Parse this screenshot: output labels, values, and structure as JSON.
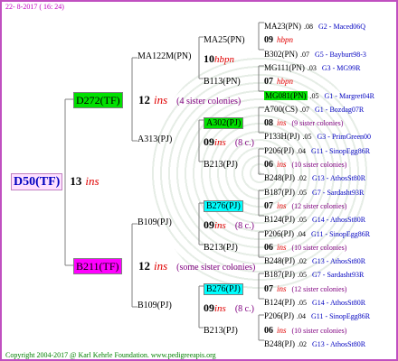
{
  "header": {
    "date": "22-  8-2017 ( 16: 24)"
  },
  "footer": {
    "copyright": "Copyright 2004-2017 @ Karl Kehrle Foundation.   www.pedigreeapis.org"
  },
  "colors": {
    "frame": "#c050c0",
    "highlight_green": "#00e000",
    "highlight_magenta": "#ff00ff",
    "highlight_cyan": "#00ffff",
    "ins_red": "#e00000",
    "link_blue": "#0000c0",
    "sisters_purple": "#800080"
  },
  "root": {
    "id": "D50(TF)",
    "ins_count": "13",
    "ins_label": "ins"
  },
  "gen1": [
    {
      "id": "D272(TF)",
      "ins_count": "12",
      "ins_label": "ins",
      "sisters": "(4 sister colonies)"
    },
    {
      "id": "B211(TF)",
      "ins_count": "12",
      "ins_label": "ins",
      "sisters": "(some sister colonies)"
    }
  ],
  "gen2": [
    "MA122M(PN)",
    "A313(PJ)",
    "B109(PJ)",
    "B109(PJ)"
  ],
  "gen3": [
    {
      "id": "MA25(PN)",
      "ins_count": "10",
      "ins_label": "hbpn"
    },
    {
      "id": "B113(PN)"
    },
    {
      "id": "A302(PJ)",
      "ins_count": "09",
      "ins_label": "ins",
      "sisters": "(8 c.)"
    },
    {
      "id": "B213(PJ)"
    },
    {
      "id": "B276(PJ)",
      "ins_count": "09",
      "ins_label": "ins",
      "sisters": "(8 c.)"
    },
    {
      "id": "B213(PJ)"
    },
    {
      "id": "B276(PJ)",
      "ins_count": "09",
      "ins_label": "ins",
      "sisters": "(8 c.)"
    },
    {
      "id": "B213(PJ)"
    }
  ],
  "gen4": [
    {
      "id": "MA23(PN)",
      "val": ".08",
      "loc": "G2 - Maced06Q"
    },
    {
      "note_count": "09",
      "note_label": "hbpn"
    },
    {
      "id": "B302(PN)",
      "val": ".07",
      "loc": "G5 - Bayburt98-3"
    },
    {
      "id": "MG111(PN)",
      "val": ".03",
      "loc": "G3 - MG99R"
    },
    {
      "note_count": "07",
      "note_label": "hbpn"
    },
    {
      "id": "MG081(PN)",
      "val": ".05",
      "loc": "G1 - Margret04R",
      "highlight": "green"
    },
    {
      "id": "A700(CS)",
      "val": ".07",
      "loc": "G1 - Bozdag07R"
    },
    {
      "note_count": "08",
      "note_label": "ins",
      "note_sisters": "(9 sister colonies)"
    },
    {
      "id": "P133H(PJ)",
      "val": ".05",
      "loc": "G3 - PrimGreen00"
    },
    {
      "id": "P206(PJ)",
      "val": ".04",
      "loc": "G11 - SinopEgg86R"
    },
    {
      "note_count": "06",
      "note_label": "ins",
      "note_sisters": "(10 sister colonies)"
    },
    {
      "id": "B248(PJ)",
      "val": ".02",
      "loc": "G13 - AthosSt80R"
    },
    {
      "id": "B187(PJ)",
      "val": ".05",
      "loc": "G7 - Sardasht93R"
    },
    {
      "note_count": "07",
      "note_label": "ins",
      "note_sisters": "(12 sister colonies)"
    },
    {
      "id": "B124(PJ)",
      "val": ".05",
      "loc": "G14 - AthosSt80R"
    },
    {
      "id": "P206(PJ)",
      "val": ".04",
      "loc": "G11 - SinopEgg86R"
    },
    {
      "note_count": "06",
      "note_label": "ins",
      "note_sisters": "(10 sister colonies)"
    },
    {
      "id": "B248(PJ)",
      "val": ".02",
      "loc": "G13 - AthosSt80R"
    },
    {
      "id": "B187(PJ)",
      "val": ".05",
      "loc": "G7 - Sardasht93R"
    },
    {
      "note_count": "07",
      "note_label": "ins",
      "note_sisters": "(12 sister colonies)"
    },
    {
      "id": "B124(PJ)",
      "val": ".05",
      "loc": "G14 - AthosSt80R"
    },
    {
      "id": "P206(PJ)",
      "val": ".04",
      "loc": "G11 - SinopEgg86R"
    },
    {
      "note_count": "06",
      "note_label": "ins",
      "note_sisters": "(10 sister colonies)"
    },
    {
      "id": "B248(PJ)",
      "val": ".02",
      "loc": "G13 - AthosSt80R"
    }
  ]
}
